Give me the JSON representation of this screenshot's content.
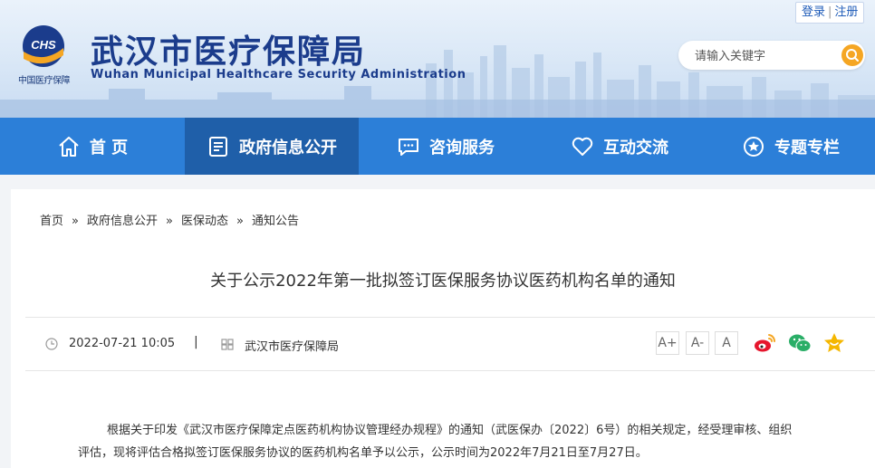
{
  "header": {
    "logo_text": "CHS",
    "logo_subtitle": "中国医疗保障",
    "site_title": "武汉市医疗保障局",
    "site_subtitle": "Wuhan Municipal Healthcare Security Administration",
    "login_label": "登录",
    "auth_separator": "|",
    "register_label": "注册",
    "search_placeholder": "请输入关键字"
  },
  "nav": {
    "items": [
      {
        "label": "首 页",
        "icon": "home-icon"
      },
      {
        "label": "政府信息公开",
        "icon": "document-icon",
        "active": true
      },
      {
        "label": "咨询服务",
        "icon": "chat-icon"
      },
      {
        "label": "互动交流",
        "icon": "heart-icon"
      },
      {
        "label": "专题专栏",
        "icon": "star-icon"
      }
    ]
  },
  "breadcrumb": {
    "items": [
      "首页",
      "政府信息公开",
      "医保动态",
      "通知公告"
    ],
    "separator": "»"
  },
  "article": {
    "title": "关于公示2022年第一批拟签订医保服务协议医药机构名单的通知",
    "date": "2022-07-21 10:05",
    "meta_separator": "|",
    "source": "武汉市医疗保障局",
    "font_buttons": [
      "A+",
      "A-",
      "A"
    ],
    "share_icons": [
      "weibo-icon",
      "wechat-icon",
      "favorite-star-icon"
    ],
    "body": "根据关于印发《武汉市医疗保障定点医药机构协议管理经办规程》的通知（武医保办〔2022〕6号）的相关规定，经受理审核、组织评估，现将评估合格拟签订医保服务协议的医药机构名单予以公示，公示时间为2022年7月21日至7月27日。"
  },
  "colors": {
    "nav_bg": "#2c7fd8",
    "nav_active": "#1f5fa9",
    "title_blue": "#1b3c8c",
    "search_button": "#f5a623",
    "weibo": "#e6162d",
    "wechat": "#2aae67",
    "star": "#f5b700"
  }
}
